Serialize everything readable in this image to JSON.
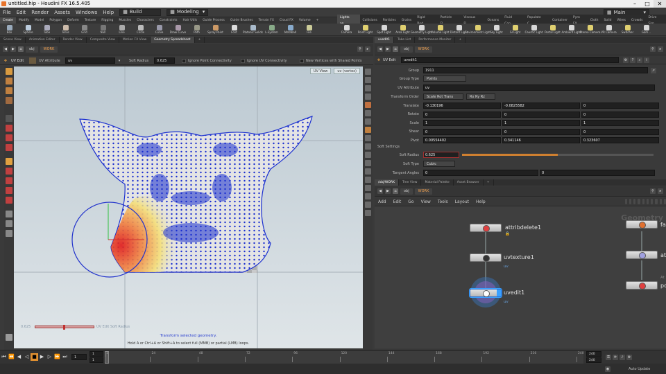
{
  "window": {
    "title": "untitled.hip - Houdini FX 16.5.405",
    "controls": [
      "–",
      "□",
      "✕"
    ]
  },
  "menubar": {
    "items": [
      "File",
      "Edit",
      "Render",
      "Assets",
      "Windows",
      "Help"
    ],
    "build": "Build",
    "desktop": "Modeling",
    "right_desktop": "Main"
  },
  "shelf": {
    "tabs_left": [
      "Create",
      "Modify",
      "Model",
      "Polygon",
      "Deform",
      "Texture",
      "Rigging",
      "Muscles",
      "Characters",
      "Constraints",
      "Hair Utils",
      "Guide Process",
      "Guide Brushes",
      "Terrain FX",
      "Cloud FX",
      "Volume"
    ],
    "tabs_right": [
      "Lights an...",
      "Collisions",
      "Particles",
      "Grains",
      "Rigid Bod...",
      "Particle Fl...",
      "Viscous Fl...",
      "Oceans",
      "Fluid Con...",
      "Populate C...",
      "Container",
      "Pyro FX",
      "Cloth",
      "Solid",
      "Wires",
      "Crowds",
      "Drive Sim"
    ],
    "tools_left": [
      "Box",
      "Sphere",
      "Tube",
      "Torus",
      "Grid",
      "Null",
      "Line",
      "Circle",
      "Curve",
      "Draw Curve",
      "Path",
      "Spray Paint",
      "Font",
      "Platonic Solids",
      "L-System",
      "Metaball",
      "File"
    ],
    "tools_right": [
      "Camera",
      "Point Light",
      "Spot Light",
      "Area Light",
      "Geometry Light",
      "Volume Light",
      "Distant Light",
      "Environment Light",
      "Sky Light",
      "GI Light",
      "Caustic Light",
      "Portal Light",
      "Ambient Light",
      "Stereo Camera",
      "VR Camera",
      "Switcher",
      "Gam..."
    ]
  },
  "left_pane": {
    "tabs": [
      "Scene View",
      "Animation Editor",
      "Render View",
      "Composite View",
      "Motion FX View",
      "Geometry Spreadsheet"
    ],
    "path": [
      "obj",
      "WORK"
    ],
    "opbar": {
      "mode": "UV Edit",
      "attribute_label": "UV Attribute",
      "attribute_value": "uv",
      "soft_radius_label": "Soft Radius",
      "soft_radius_value": "0.625",
      "ignore_point": "Ignore Point Connectivity",
      "ignore_uv": "Ignore UV Connectivity",
      "new_vertices": "New Vertices with Shared Points"
    },
    "view_dropdowns": [
      "UV View",
      "uv (vertex)"
    ],
    "viewport_readout": "0.625",
    "viewport_slider_label": "UV Edit Soft Radius",
    "viewport_slider_value": 0.48,
    "status_main": "Transform selected geometry.",
    "status_hint": "Hold A or Ctrl+A or Shift+A to select full (MMB) or partial (LMB) loops."
  },
  "param_pane": {
    "tabs": [
      "uvedit1",
      "Take List",
      "Performance Monitor"
    ],
    "path": [
      "obj",
      "WORK"
    ],
    "node_type": "UV Edit",
    "node_name": "uvedit1",
    "group_label": "Group",
    "group_value": "1911",
    "group_type_label": "Group Type",
    "group_type_value": "Points",
    "uv_attr_label": "UV Attribute",
    "uv_attr_value": "uv",
    "transform_order_label": "Transform Order",
    "transform_order_value": "Scale Rot Trans",
    "rot_order_value": "Rx Ry Rz",
    "rows": [
      {
        "label": "Translate",
        "values": [
          "-0.130196",
          "-0.0825582",
          "0"
        ]
      },
      {
        "label": "Rotate",
        "values": [
          "0",
          "0",
          "0"
        ]
      },
      {
        "label": "Scale",
        "values": [
          "1",
          "1",
          "1"
        ]
      },
      {
        "label": "Shear",
        "values": [
          "0",
          "0",
          "0"
        ]
      },
      {
        "label": "Pivot",
        "values": [
          "0.00554402",
          "0.341146",
          "0.323607"
        ]
      }
    ],
    "soft_section": "Soft Settings",
    "soft_radius_label": "Soft Radius",
    "soft_radius_value": "0.625",
    "soft_radius_fraction": 0.5,
    "soft_type_label": "Soft Type",
    "soft_type_value": "Cubic",
    "tangent_label": "Tangent Angles",
    "tangent_values": [
      "0",
      "0"
    ]
  },
  "network_pane": {
    "tabs": [
      "/obj/WORK",
      "Tree View",
      "Material Palette",
      "Asset Browser"
    ],
    "path": [
      "obj",
      "WORK"
    ],
    "menu": [
      "Add",
      "Edit",
      "Go",
      "View",
      "Tools",
      "Layout",
      "Help"
    ],
    "watermark": "Geometry",
    "nodes": [
      {
        "name": "attribdelete1",
        "sub": ""
      },
      {
        "name": "uvtexture1",
        "sub": "uv"
      },
      {
        "name": "uvedit1",
        "sub": "uv"
      }
    ],
    "side_nodes": [
      "fa",
      "at",
      "po"
    ],
    "side_label": "At"
  },
  "timeline": {
    "current_frame": "1",
    "start": "1",
    "ticks": [
      "1",
      "24",
      "48",
      "72",
      "96",
      "120",
      "144",
      "168",
      "192",
      "216",
      "240"
    ],
    "end_a": "240",
    "end_b": "240",
    "auto_update": "Auto Update"
  },
  "colors": {
    "accent_orange": "#f0a050",
    "selection_red": "#e02020",
    "point_blue": "#1a2fd0",
    "uv_blue": "#6aa4e0"
  }
}
